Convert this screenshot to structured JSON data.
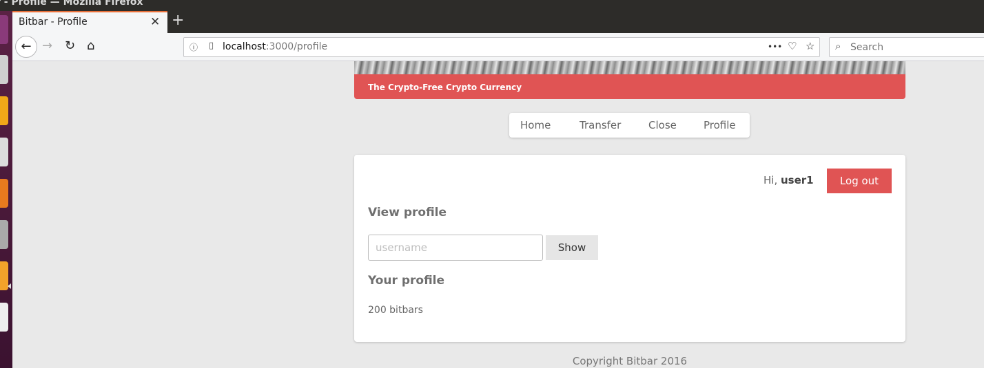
{
  "os": {
    "window_title": "r - Profile — Mozilla Firefox"
  },
  "browser": {
    "tab": {
      "title": "Bitbar - Profile",
      "close_glyph": "✕"
    },
    "new_tab_glyph": "+",
    "nav": {
      "back_glyph": "←",
      "forward_glyph": "→",
      "reload_glyph": "↻",
      "home_glyph": "⌂"
    },
    "url": {
      "host": "localhost",
      "rest": ":3000/profile"
    },
    "url_actions": {
      "more_glyph": "•••",
      "pocket_glyph": "♡",
      "bookmark_glyph": "☆",
      "info_glyph": "ⓘ",
      "page_glyph": "▯"
    },
    "search": {
      "placeholder": "Search",
      "icon_glyph": "⌕"
    }
  },
  "site": {
    "tagline": "The Crypto-Free Crypto Currency",
    "nav": [
      "Home",
      "Transfer",
      "Close",
      "Profile"
    ],
    "greeting_prefix": "Hi,",
    "username": "user1",
    "logout_label": "Log out",
    "view_profile_heading": "View profile",
    "username_placeholder": "username",
    "show_label": "Show",
    "your_profile_heading": "Your profile",
    "balance": "200 bitbars",
    "footer": "Copyright Bitbar 2016"
  },
  "colors": {
    "accent": "#e05454",
    "background": "#e9e9e9",
    "firefox_tab_accent": "#e8703a",
    "launcher": "#5b2245"
  }
}
